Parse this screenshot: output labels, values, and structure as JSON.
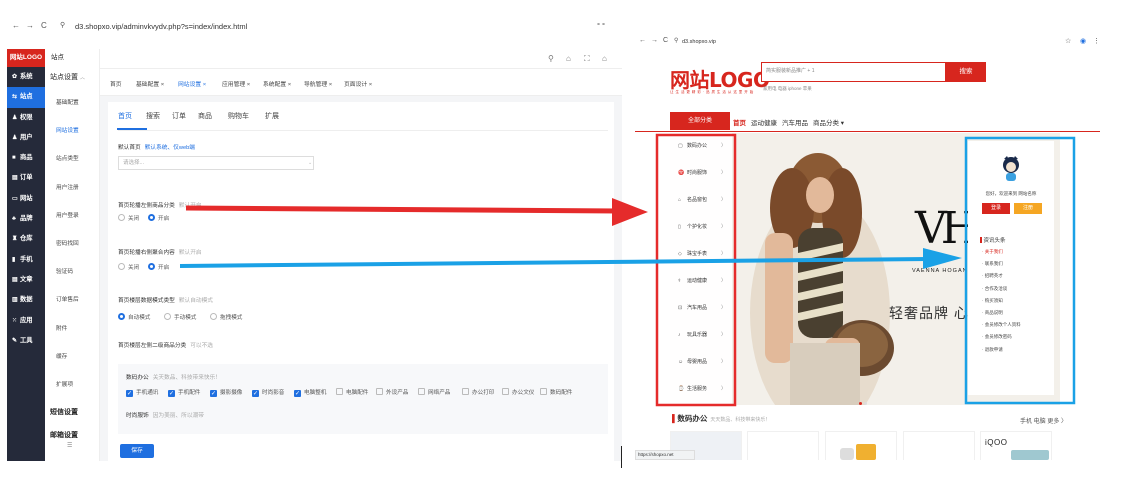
{
  "colors": {
    "red": "#d7261e",
    "blue": "#1f6fe0",
    "annot_red": "#e52b2b",
    "annot_blue": "#1aa1e6",
    "dark_sidebar": "#252a3a"
  },
  "admin": {
    "url": "d3.shopxo.vip/adminvkvydv.php?s=index/index.html",
    "logo": "网站LOGO",
    "sidebar": [
      {
        "label": "系统",
        "icon": "gear-icon"
      },
      {
        "label": "站点",
        "icon": "sliders-icon",
        "active": true
      },
      {
        "label": "权限",
        "icon": "user-lock-icon"
      },
      {
        "label": "用户",
        "icon": "user-icon"
      },
      {
        "label": "商品",
        "icon": "box-icon"
      },
      {
        "label": "订单",
        "icon": "order-icon"
      },
      {
        "label": "网站",
        "icon": "monitor-icon"
      },
      {
        "label": "品牌",
        "icon": "brand-icon"
      },
      {
        "label": "仓库",
        "icon": "warehouse-icon"
      },
      {
        "label": "手机",
        "icon": "phone-icon"
      },
      {
        "label": "文章",
        "icon": "article-icon"
      },
      {
        "label": "数据",
        "icon": "chart-icon"
      },
      {
        "label": "应用",
        "icon": "apps-icon"
      },
      {
        "label": "工具",
        "icon": "wrench-icon"
      }
    ],
    "subnav": {
      "head": "站点",
      "group": "站点设置",
      "items": [
        "基础配置",
        "网站设置",
        "站点类型",
        "用户注册",
        "用户登录",
        "密码找回",
        "验证码",
        "订单售后",
        "附件",
        "缓存",
        "扩展项"
      ],
      "active": 1,
      "group2": "短信设置",
      "group3": "邮箱设置"
    },
    "tabs": [
      "首页",
      "基础配置 ×",
      "网站设置 ×",
      "应用管理 ×",
      "系统配置 ×",
      "导航管理 ×",
      "页面设计 ×"
    ],
    "tabs_active": 2,
    "page_tabs": [
      "首页",
      "搜索",
      "订单",
      "商品",
      "购物车",
      "扩展"
    ],
    "default_home": {
      "label": "默认首页",
      "hint": "默认系统、仅web端",
      "placeholder": "请选择..."
    },
    "left_cat": {
      "label": "首页轮播左侧商品分类",
      "hint": "默认开启",
      "off": "关闭",
      "on": "开启"
    },
    "right_agg": {
      "label": "首页轮播右侧聚合内容",
      "hint": "默认开启",
      "off": "关闭",
      "on": "开启"
    },
    "floor_mode": {
      "label": "首页楼层数据模式类型",
      "hint": "默认自动模式",
      "options": [
        "自动模式",
        "手动模式",
        "拖拽模式"
      ]
    },
    "floor_left": {
      "label": "首页楼层左侧二级商品分类",
      "hint": "可以不选"
    },
    "digital": {
      "label": "数码办公",
      "hint": "关天数品、科技带来快乐！",
      "items": [
        {
          "t": "手机通讯",
          "on": true
        },
        {
          "t": "手机配件",
          "on": true
        },
        {
          "t": "摄影摄像",
          "on": true
        },
        {
          "t": "时尚影音",
          "on": true
        },
        {
          "t": "电脑整机",
          "on": true
        },
        {
          "t": "电脑配件",
          "on": false
        },
        {
          "t": "外设产品",
          "on": false
        },
        {
          "t": "网络产品",
          "on": false
        },
        {
          "t": "办公打印",
          "on": false
        },
        {
          "t": "办公文仪",
          "on": false
        },
        {
          "t": "数码配件",
          "on": false
        }
      ]
    },
    "fashion": {
      "label": "时尚服饰",
      "hint": "因为美丽、所以潮带"
    },
    "save": "保存"
  },
  "shop": {
    "url": "d3.shopxo.vip",
    "logo": "网站LOGO",
    "tagline": "让 生 活 更 精 彩 · 品 质 生 活 从 这 里 开 始",
    "search_placeholder": "简实服装新品推广 + 1",
    "search_btn": "搜索",
    "hotwords": "家用电  电器  iphone  苹果",
    "all_cat": "全部分类",
    "nav": [
      "首页",
      "运动健康",
      "汽车用品",
      "商品分类 ▾"
    ],
    "categories": [
      {
        "t": "数码办公",
        "i": "▢"
      },
      {
        "t": "时尚服饰",
        "i": "♈"
      },
      {
        "t": "名品窗包",
        "i": "⌂"
      },
      {
        "t": "个护化妆",
        "i": "▯"
      },
      {
        "t": "珠宝手表",
        "i": "◇"
      },
      {
        "t": "运动健康",
        "i": "⚕"
      },
      {
        "t": "汽车用品",
        "i": "⊡"
      },
      {
        "t": "玩具乐器",
        "i": "♪"
      },
      {
        "t": "母婴用品",
        "i": "☺"
      },
      {
        "t": "生活服务",
        "i": "⌚"
      }
    ],
    "banner_brand": "VH",
    "banner_brand_full": "VAENNA HOGAN",
    "banner_slogan": "轻奢品牌 心动好",
    "welcome": "您好，欢迎来到 网站名称",
    "login": "登录",
    "register": "注册",
    "news_head": "资讯头条",
    "news": [
      {
        "t": "关于我们",
        "red": true
      },
      {
        "t": "联系我们"
      },
      {
        "t": "招聘英才"
      },
      {
        "t": "合作及洽谈"
      },
      {
        "t": "购买须知"
      },
      {
        "t": "商品说明"
      },
      {
        "t": "会员修改个人资料"
      },
      {
        "t": "会员修改密码"
      },
      {
        "t": "退款申请"
      }
    ],
    "section": "数码办公",
    "section_hint": "天天数品、科技带来快乐！",
    "section_right": "手机  电脑  更多 〉",
    "iqoo": "iQOO",
    "status": "https://shopxo.net"
  }
}
